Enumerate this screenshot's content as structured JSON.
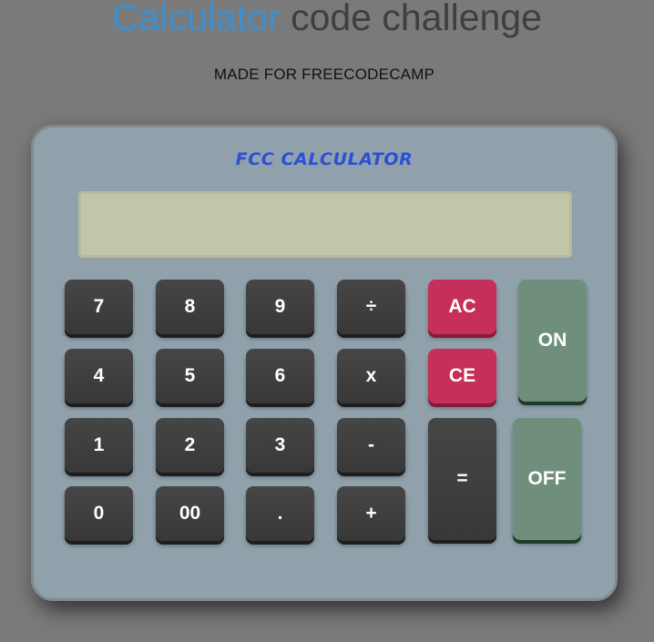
{
  "header": {
    "title_accent": "Calculator",
    "title_rest": "code challenge",
    "subtitle": "MADE FOR FREECODECAMP"
  },
  "calculator": {
    "brand": "FCC CALCULATOR",
    "display_value": "",
    "keys": {
      "seven": "7",
      "eight": "8",
      "nine": "9",
      "divide": "÷",
      "all_clear": "AC",
      "on": "ON",
      "four": "4",
      "five": "5",
      "six": "6",
      "multiply": "x",
      "clear_entry": "CE",
      "one": "1",
      "two": "2",
      "three": "3",
      "subtract": "-",
      "equals": "=",
      "off": "OFF",
      "zero": "0",
      "double_zero": "00",
      "decimal": ".",
      "add": "+"
    }
  },
  "colors": {
    "background": "#7a7a7a",
    "title_accent": "#3d8fd0",
    "title_text": "#3f3f3f",
    "calculator_body": "#90a1ac",
    "brand_text": "#2b4fd6",
    "display": "#c3c5a9",
    "dark_key": "#404040",
    "red_key": "#c63058",
    "green_key": "#6f8f7c"
  }
}
